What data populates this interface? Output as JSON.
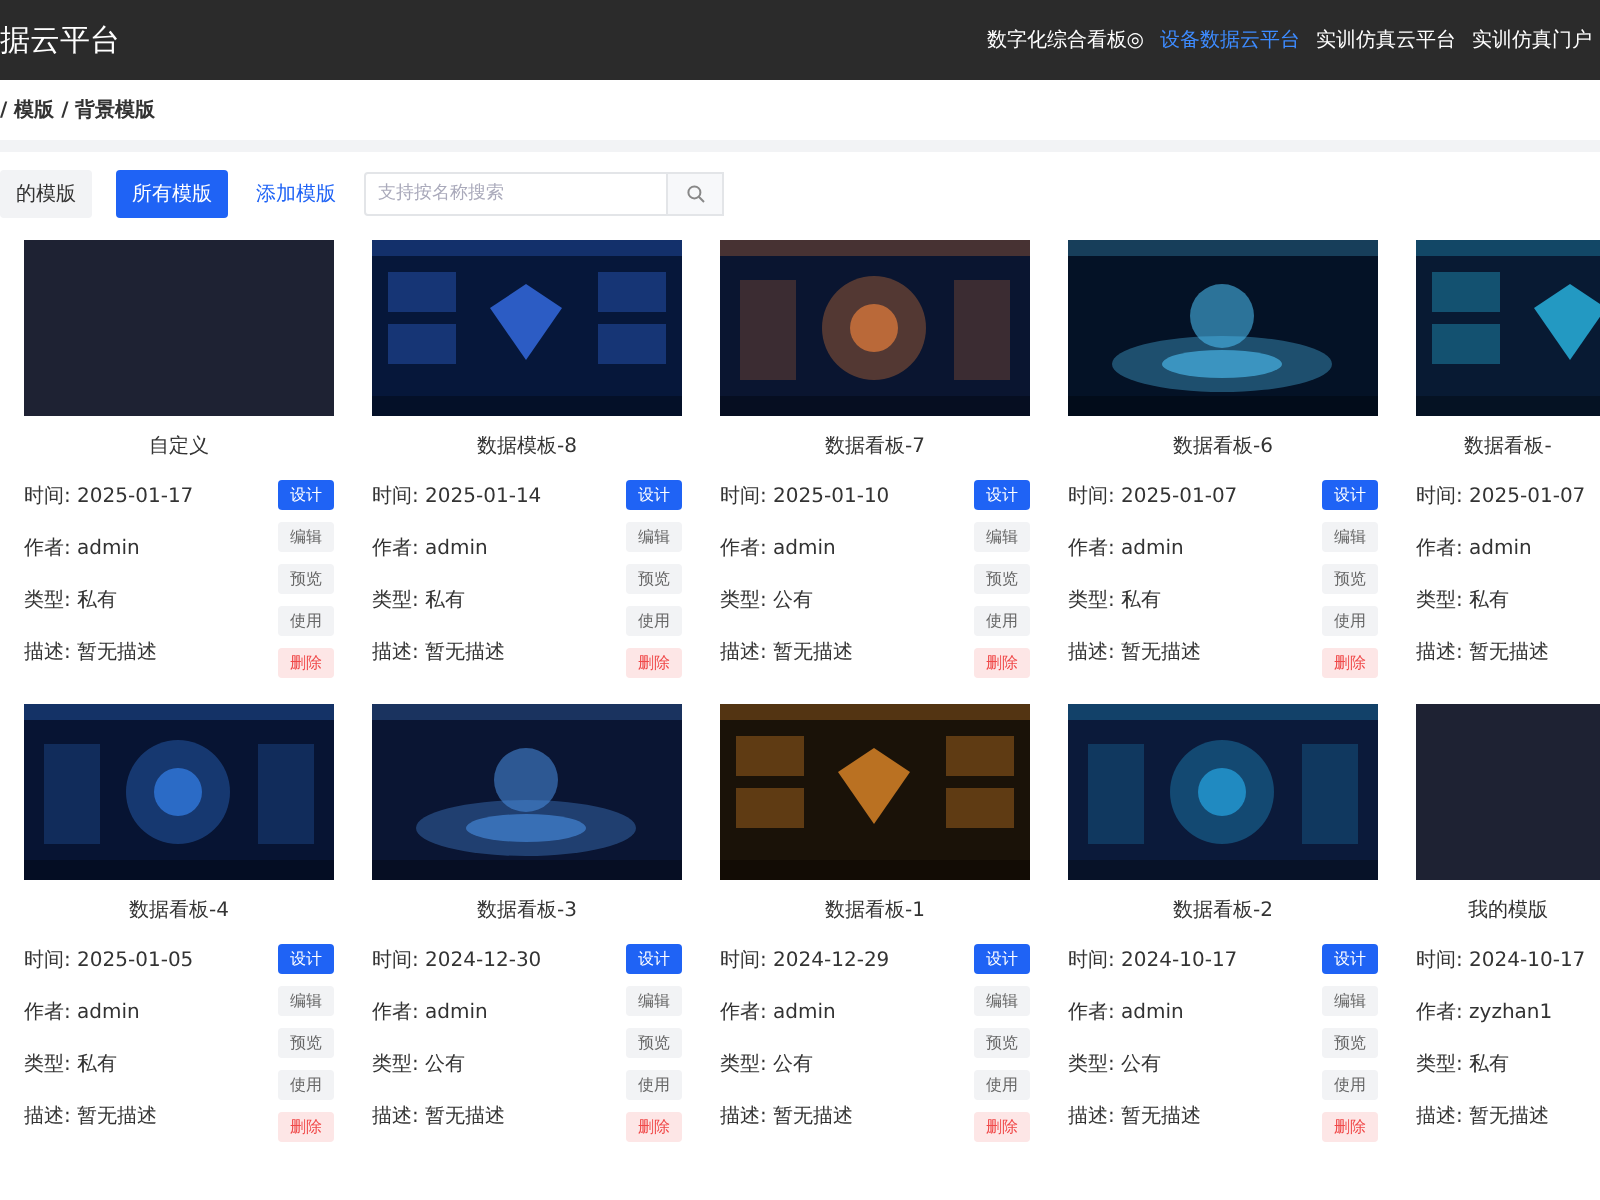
{
  "header": {
    "title": "据云平台",
    "nav": [
      {
        "label": "数字化综合看板◎",
        "selected": false
      },
      {
        "label": "设备数据云平台",
        "selected": true
      },
      {
        "label": "实训仿真云平台",
        "selected": false
      },
      {
        "label": "实训仿真门户",
        "selected": false
      }
    ]
  },
  "breadcrumb": "/ 模版 / 背景模版",
  "toolbar": {
    "tabs": [
      {
        "label": "的模版",
        "selected": false
      },
      {
        "label": "所有模版",
        "selected": true
      }
    ],
    "add_link": "添加模版",
    "search": {
      "placeholder": "支持按名称搜索"
    }
  },
  "cards": [
    {
      "title": "自定义",
      "info": [
        "时间: 2025-01-17",
        "作者: admin",
        "类型: 私有",
        "描述: 暂无描述"
      ],
      "buttons": [
        {
          "label": "设计",
          "kind": "primary"
        },
        {
          "label": "编辑",
          "kind": "plain"
        },
        {
          "label": "预览",
          "kind": "plain"
        },
        {
          "label": "使用",
          "kind": "plain"
        },
        {
          "label": "删除",
          "kind": "danger"
        }
      ]
    },
    {
      "title": "数据模板-8",
      "kind": "picture",
      "info": [
        "时间: 2025-01-14",
        "作者: admin",
        "类型: 私有",
        "描述: 暂无描述"
      ],
      "buttons": [
        {
          "label": "设计",
          "kind": "primary"
        },
        {
          "label": "编辑",
          "kind": "plain"
        },
        {
          "label": "预览",
          "kind": "plain"
        },
        {
          "label": "使用",
          "kind": "plain"
        },
        {
          "label": "删除",
          "kind": "danger"
        }
      ]
    },
    {
      "title": "数据看板-7",
      "kind": "picture",
      "info": [
        "时间: 2025-01-10",
        "作者: admin",
        "类型: 公有",
        "描述: 暂无描述"
      ],
      "buttons": [
        {
          "label": "设计",
          "kind": "primary"
        },
        {
          "label": "编辑",
          "kind": "plain"
        },
        {
          "label": "预览",
          "kind": "plain"
        },
        {
          "label": "使用",
          "kind": "plain"
        },
        {
          "label": "删除",
          "kind": "danger"
        }
      ]
    },
    {
      "title": "数据看板-6",
      "kind": "picture",
      "info": [
        "时间: 2025-01-07",
        "作者: admin",
        "类型: 私有",
        "描述: 暂无描述"
      ],
      "buttons": [
        {
          "label": "设计",
          "kind": "primary"
        },
        {
          "label": "编辑",
          "kind": "plain"
        },
        {
          "label": "预览",
          "kind": "plain"
        },
        {
          "label": "使用",
          "kind": "plain"
        },
        {
          "label": "删除",
          "kind": "danger"
        }
      ]
    },
    {
      "title": "数据看板-",
      "kind": "picture",
      "info": [
        "时间: 2025-01-07",
        "作者: admin",
        "类型: 私有",
        "描述: 暂无描述"
      ]
    },
    {
      "title": "数据看板-4",
      "kind": "picture",
      "info": [
        "时间: 2025-01-05",
        "作者: admin",
        "类型: 私有",
        "描述: 暂无描述"
      ],
      "buttons": [
        {
          "label": "设计",
          "kind": "primary"
        },
        {
          "label": "编辑",
          "kind": "plain"
        },
        {
          "label": "预览",
          "kind": "plain"
        },
        {
          "label": "使用",
          "kind": "plain"
        },
        {
          "label": "删除",
          "kind": "danger"
        }
      ]
    },
    {
      "title": "数据看板-3",
      "kind": "picture",
      "info": [
        "时间: 2024-12-30",
        "作者: admin",
        "类型: 公有",
        "描述: 暂无描述"
      ],
      "buttons": [
        {
          "label": "设计",
          "kind": "primary"
        },
        {
          "label": "编辑",
          "kind": "plain"
        },
        {
          "label": "预览",
          "kind": "plain"
        },
        {
          "label": "使用",
          "kind": "plain"
        },
        {
          "label": "删除",
          "kind": "danger"
        }
      ]
    },
    {
      "title": "数据看板-1",
      "kind": "picture",
      "info": [
        "时间: 2024-12-29",
        "作者: admin",
        "类型: 公有",
        "描述: 暂无描述"
      ],
      "buttons": [
        {
          "label": "设计",
          "kind": "primary"
        },
        {
          "label": "编辑",
          "kind": "plain"
        },
        {
          "label": "预览",
          "kind": "plain"
        },
        {
          "label": "使用",
          "kind": "plain"
        },
        {
          "label": "删除",
          "kind": "danger"
        }
      ]
    },
    {
      "title": "数据看板-2",
      "kind": "picture",
      "info": [
        "时间: 2024-10-17",
        "作者: admin",
        "类型: 公有",
        "描述: 暂无描述"
      ],
      "buttons": [
        {
          "label": "设计",
          "kind": "primary"
        },
        {
          "label": "编辑",
          "kind": "plain"
        },
        {
          "label": "预览",
          "kind": "plain"
        },
        {
          "label": "使用",
          "kind": "plain"
        },
        {
          "label": "删除",
          "kind": "danger"
        }
      ]
    },
    {
      "title": "我的模版",
      "info": [
        "时间: 2024-10-17",
        "作者: zyzhan1",
        "类型: 私有",
        "描述: 暂无描述"
      ]
    }
  ]
}
